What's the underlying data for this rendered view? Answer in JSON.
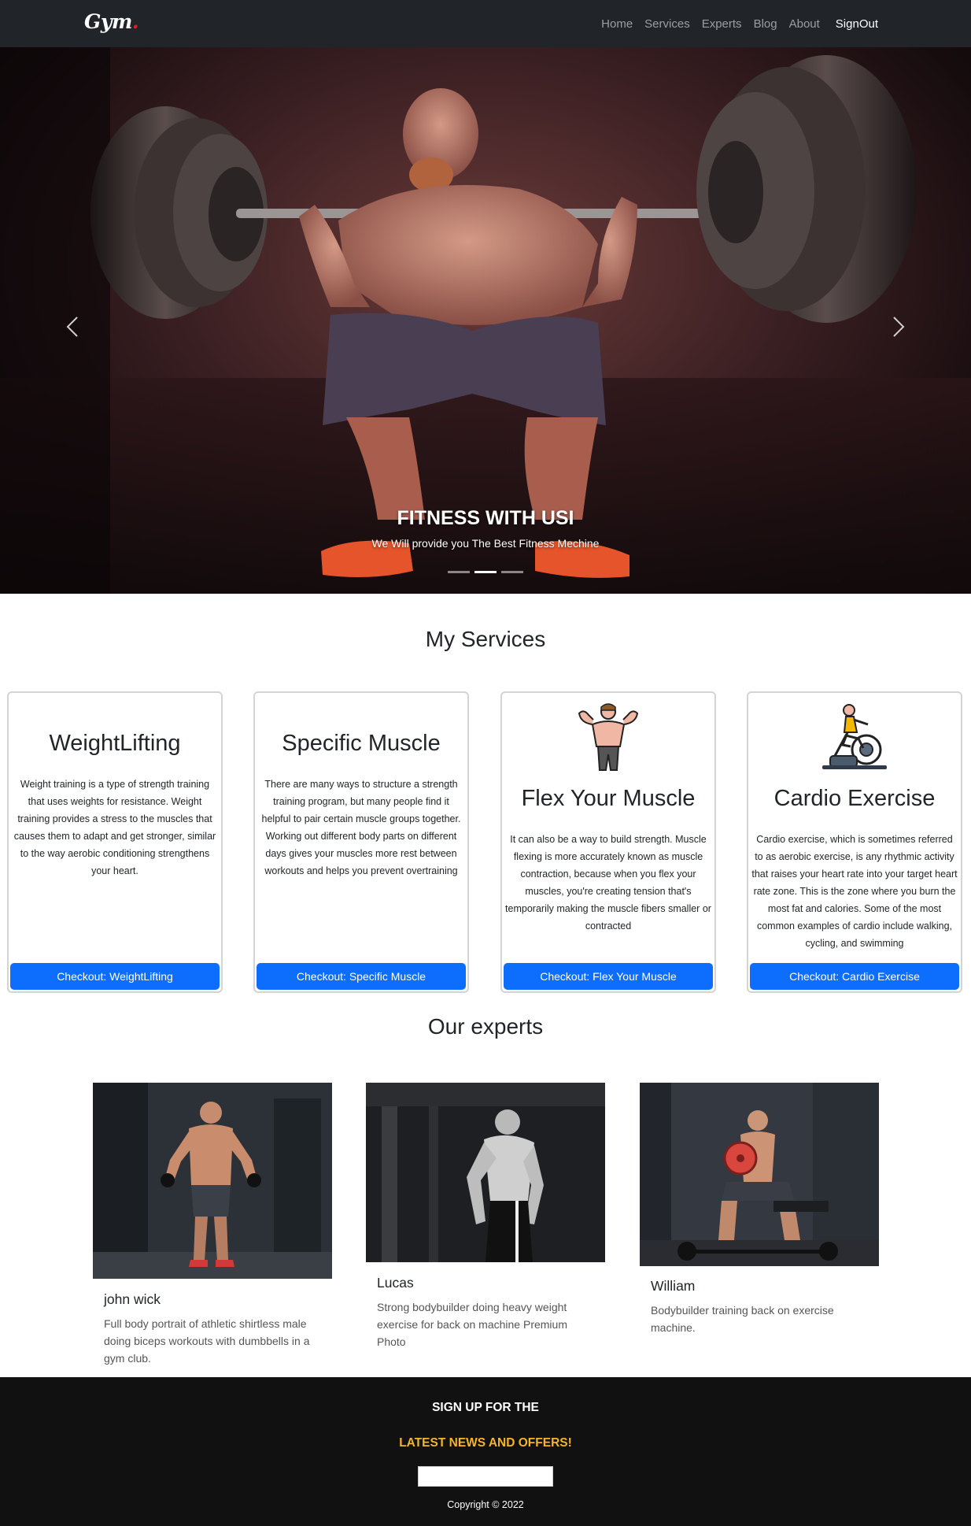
{
  "nav": {
    "brand": "Gym",
    "brand_dot": ".",
    "links": [
      "Home",
      "Services",
      "Experts",
      "Blog",
      "About"
    ],
    "signout": "SignOut"
  },
  "hero": {
    "title": "FITNESS WITH USI",
    "subtitle": "We Will provide you The Best Fitness Mechine",
    "slides_count": 3,
    "active_slide": 2,
    "prev_icon": "chevron-left-icon",
    "next_icon": "chevron-right-icon"
  },
  "services": {
    "title": "My Services",
    "cards": [
      {
        "title": "WeightLifting",
        "text": "Weight training is a type of strength training that uses weights for resistance. Weight training provides a stress to the muscles that causes them to adapt and get stronger, similar to the way aerobic conditioning strengthens your heart.",
        "button": "Checkout: WeightLifting"
      },
      {
        "title": "Specific Muscle",
        "text": "There are many ways to structure a strength training program, but many people find it helpful to pair certain muscle groups together. Working out different body parts on different days gives your muscles more rest between workouts and helps you prevent overtraining",
        "button": "Checkout: Specific Muscle"
      },
      {
        "title": "Flex Your Muscle",
        "icon": "bodybuilder-icon",
        "text": "It can also be a way to build strength. Muscle flexing is more accurately known as muscle contraction, because when you flex your muscles, you're creating tension that's temporarily making the muscle fibers smaller or contracted",
        "button": "Checkout: Flex Your Muscle"
      },
      {
        "title": "Cardio Exercise",
        "icon": "exercise-bike-icon",
        "text": "Cardio exercise, which is sometimes referred to as aerobic exercise, is any rhythmic activity that raises your heart rate into your target heart rate zone. This is the zone where you burn the most fat and calories. Some of the most common examples of cardio include walking, cycling, and swimming",
        "button": "Checkout: Cardio Exercise"
      }
    ]
  },
  "experts": {
    "title": "Our experts",
    "items": [
      {
        "name": "john wick",
        "desc": "Full body portrait of athletic shirtless male doing biceps workouts with dumbbells in a gym club."
      },
      {
        "name": "Lucas",
        "desc": "Strong bodybuilder doing heavy weight exercise for back on machine Premium Photo"
      },
      {
        "name": "William",
        "desc": "Bodybuilder training back on exercise machine."
      }
    ]
  },
  "footer": {
    "line1": "SIGN UP FOR THE",
    "line2": "LATEST NEWS AND OFFERS!",
    "copyright": "Copyright © 2022"
  },
  "colors": {
    "nav_bg": "#212529",
    "primary_button": "#0d6efd",
    "brand_dot": "#e11d2a",
    "footer_bg": "#111111",
    "offer_text": "#f6b426"
  }
}
